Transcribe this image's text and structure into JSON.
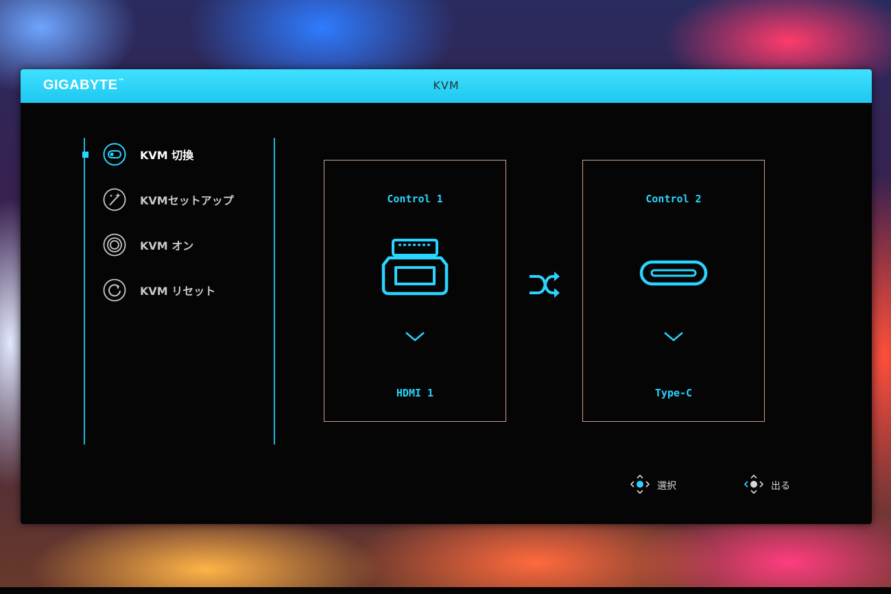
{
  "header": {
    "brand": "GIGABYTE",
    "brand_tm": "™",
    "title": "KVM"
  },
  "menu": {
    "items": [
      {
        "label": "KVM 切換",
        "icon": "toggle-icon",
        "active": true
      },
      {
        "label": "KVMセットアップ",
        "icon": "wand-icon",
        "active": false
      },
      {
        "label": "KVM オン",
        "icon": "power-ring-icon",
        "active": false
      },
      {
        "label": "KVM リセット",
        "icon": "reset-icon",
        "active": false
      }
    ]
  },
  "controls": [
    {
      "title": "Control 1",
      "port": "HDMI 1",
      "icon": "hdmi-port-icon"
    },
    {
      "title": "Control 2",
      "port": "Type-C",
      "icon": "usb-c-port-icon"
    }
  ],
  "swap": {
    "icon": "swap-icon"
  },
  "hints": [
    {
      "label": "選択",
      "icon": "joystick-select-icon"
    },
    {
      "label": "出る",
      "icon": "joystick-exit-icon"
    }
  ],
  "colors": {
    "accent": "#2ad4ff",
    "header": "#1ec8f0",
    "box_border": "#c9a48e",
    "background": "#050505"
  }
}
